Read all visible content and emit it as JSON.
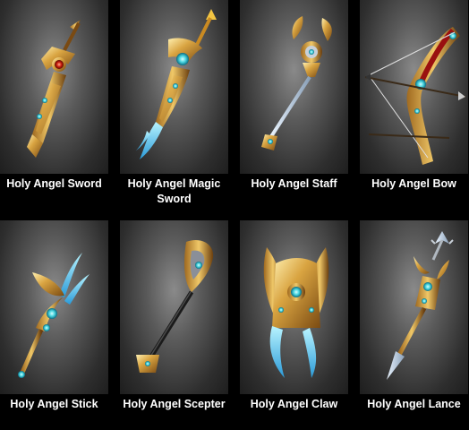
{
  "items": [
    {
      "label": "Holy Angel Sword"
    },
    {
      "label": "Holy Angel Magic Sword"
    },
    {
      "label": "Holy Angel Staff"
    },
    {
      "label": "Holy Angel Bow"
    },
    {
      "label": "Holy Angel Stick"
    },
    {
      "label": "Holy Angel Scepter"
    },
    {
      "label": "Holy Angel Claw"
    },
    {
      "label": "Holy Angel Lance"
    }
  ],
  "colors": {
    "background": "#000000",
    "label": "#ffffff",
    "gold": "#d9a441",
    "gem": "#49d6e0"
  }
}
